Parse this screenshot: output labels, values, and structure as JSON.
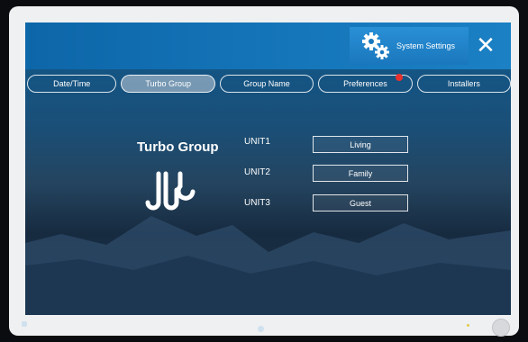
{
  "header": {
    "settings_label": "System Settings",
    "close_label": "✕"
  },
  "tabs": [
    {
      "label": "Date/Time",
      "active": false,
      "badge": false
    },
    {
      "label": "Turbo Group",
      "active": true,
      "badge": false
    },
    {
      "label": "Group Name",
      "active": false,
      "badge": false
    },
    {
      "label": "Preferences",
      "active": false,
      "badge": true
    },
    {
      "label": "Installers",
      "active": false,
      "badge": false
    }
  ],
  "main": {
    "title": "Turbo Group",
    "units": [
      {
        "label": "UNIT1",
        "value": "Living"
      },
      {
        "label": "UNIT2",
        "value": "Family"
      },
      {
        "label": "UNIT3",
        "value": "Guest"
      }
    ]
  },
  "colors": {
    "header": "#1677bb",
    "badge": "#e8312f"
  }
}
